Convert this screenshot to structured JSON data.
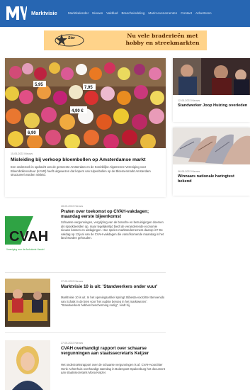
{
  "site": {
    "brand": "Marktvisie",
    "nav": [
      "Marktkalender",
      "Nieuws",
      "Vakblad",
      "Brancheindeling",
      "Markt-evenementen",
      "Contact",
      "Adverteren"
    ]
  },
  "banner": {
    "line1": "Nu vele braderieën met",
    "line2": "hobby en streekmarkten",
    "logo_text": "Star"
  },
  "featured": {
    "meta": "15-05-2022 Nieuws",
    "title": "Misleiding bij verkoop bloembollen op Amsterdamse markt",
    "excerpt": "Een onderzoek in opdracht van de gemeente Amsterdam en de Koninklijke Algemeene Vereniging voor Bloembollencultuur (KAVB) heeft uitgewezen dat kopers van tulpenbollen op de Bloemenmarkt Amsterdam structureel worden misleid.",
    "price_tags": [
      "4,90 €",
      "6,90",
      "5,95",
      "7,95"
    ]
  },
  "side": [
    {
      "meta": "12-05-2022 Nieuws",
      "title": "Standwerker Joop Huizing overleden"
    },
    {
      "meta": "06-05-2022 Nieuws",
      "title": "Winnaars nationale haringtest bekend"
    }
  ],
  "articles": [
    {
      "meta": "28-05-2022 Nieuws",
      "title": "Praten over toekomst op CVAH-vakdagen; maandag eerste bijeenkomst",
      "excerpt": "Schaarse vergunningen, vergrijzing van de branche en bezuinigingen doemen als spookbeelden op, maar tegelijkertijd biedt de veranderende economie nieuwe kansen en uitdagingen. Hoe spelen marktondernemers daarop in? De vakdag op 13 juni van de CVAH-vakdagen die vanaf komende maandag in het land worden gehouden.",
      "thumb_text": "CVAH",
      "thumb_sub": "Vereniging voor de Ambulante Handel"
    },
    {
      "meta": "27-05-2022 Nieuws",
      "title": "Marktvisie 10 is uit: 'Standwerkers onder vuur'",
      "excerpt": "Marktvisie 10 is uit. In het openingsartikel springt Stibesta-voorzitter Benvenido van Schaik in de bres voor 'het oudste beroep in het marktwezen': \"Standwerkers hebben bescherming nodig\", vindt hij."
    },
    {
      "meta": "27-05-2022 Nieuws",
      "title": "CVAH overhandigt rapport over schaarse vergunningen aan staatssecretaris Keijzer",
      "excerpt": "Het onderzoeksrapport over de schaarse vergunningen is af. CVAH-voorzitter Henk Achterhuis overhandigt zaterdag in Buitenpost-Spakenburg het document aan staatssecretaris Mona Keijzer."
    }
  ],
  "colors": {
    "header": "#2766b2",
    "banner": "#ffd38a",
    "cvah_green": "#2fa344"
  }
}
